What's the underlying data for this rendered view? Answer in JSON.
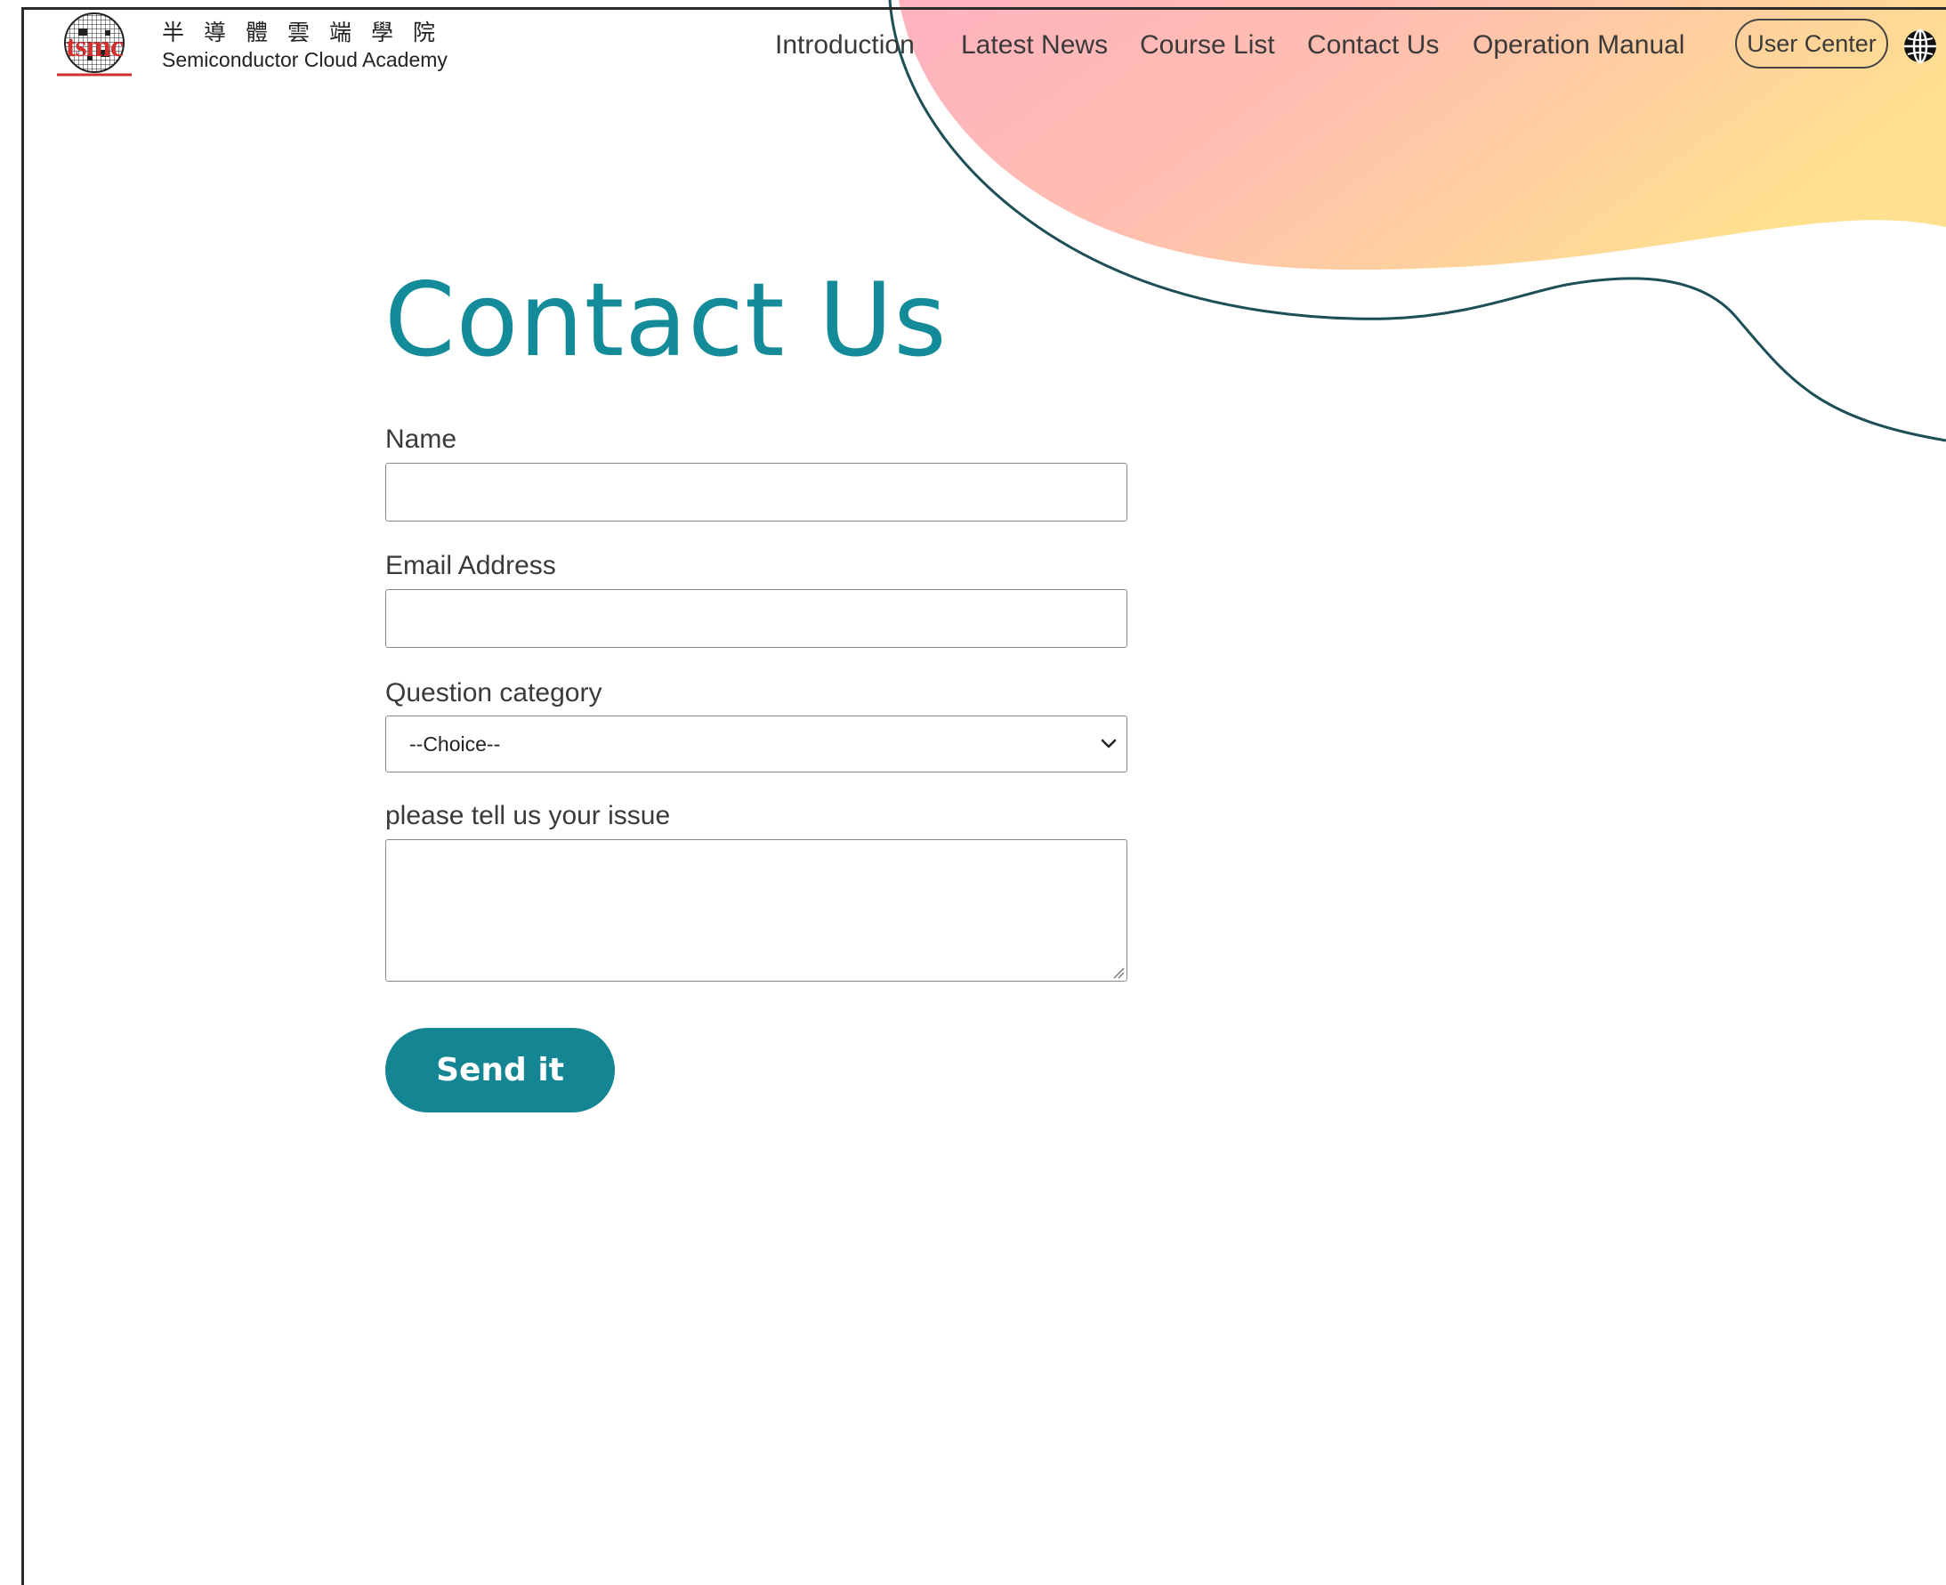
{
  "header": {
    "logo": {
      "wordmark": "tsmc",
      "chinese_name": "半導體雲端學院",
      "english_name": "Semiconductor Cloud Academy"
    },
    "nav": [
      {
        "label": "Introduction"
      },
      {
        "label": "Latest News"
      },
      {
        "label": "Course List"
      },
      {
        "label": "Contact Us"
      },
      {
        "label": "Operation Manual"
      }
    ],
    "user_center_label": "User Center",
    "language_icon": "globe-icon"
  },
  "main": {
    "title": "Contact Us",
    "form": {
      "name": {
        "label": "Name",
        "value": "",
        "placeholder": ""
      },
      "email": {
        "label": "Email Address",
        "value": "",
        "placeholder": ""
      },
      "category": {
        "label": "Question category",
        "selected": "--Choice--"
      },
      "issue": {
        "label": "please tell us your issue",
        "value": ""
      },
      "submit_label": "Send it"
    }
  },
  "colors": {
    "accent": "#148b98",
    "button": "#138593",
    "blob_pink": "#ffb3c1",
    "blob_yellow": "#ffe08f",
    "curve_stroke": "#1d4f57",
    "logo_red": "#d32f2f"
  }
}
